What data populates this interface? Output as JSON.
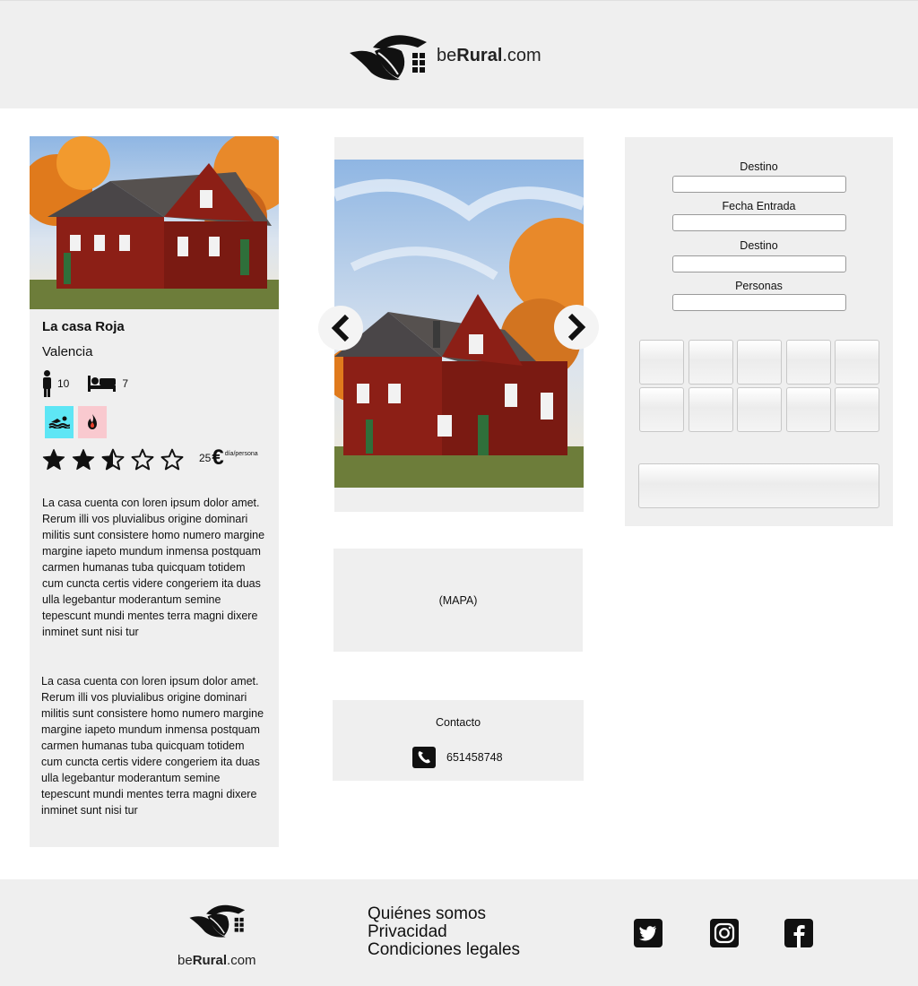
{
  "brand": {
    "prefix": "be",
    "bold": "Rural",
    "suffix": ".com"
  },
  "listing": {
    "name": "La casa Roja",
    "location": "Valencia",
    "guests": "10",
    "beds": "7",
    "amenities": [
      {
        "icon": "swimming-pool-icon",
        "color": "#5ee6f5"
      },
      {
        "icon": "fire-icon",
        "color": "#f9c9cf",
        "icon_color": "#e8412c"
      }
    ],
    "rating": 2.5,
    "rating_max": 5,
    "price_value": "25",
    "price_currency": "€",
    "price_unit": "día/persona",
    "description_1": "La casa cuenta con loren ipsum dolor amet. Rerum illi vos pluvialibus origine dominari militis sunt consistere homo numero margine margine iapeto mundum inmensa postquam carmen humanas tuba quicquam totidem cum cuncta certis videre congeriem ita duas ulla legebantur moderantum semine tepescunt mundi mentes terra magni dixere inminet sunt nisi tur",
    "description_2": "La casa cuenta con loren ipsum dolor amet. Rerum illi vos pluvialibus origine dominari militis sunt consistere homo numero margine margine iapeto mundum inmensa postquam carmen humanas tuba quicquam totidem cum cuncta certis videre congeriem ita duas ulla legebantur moderantum semine tepescunt mundi mentes terra magni dixere inminet sunt nisi tur"
  },
  "map": {
    "label": "(MAPA)"
  },
  "contact": {
    "title": "Contacto",
    "phone": "651458748"
  },
  "search": {
    "fields": [
      {
        "label": "Destino",
        "value": ""
      },
      {
        "label": "Fecha Entrada",
        "value": ""
      },
      {
        "label": "Destino",
        "value": ""
      },
      {
        "label": "Personas",
        "value": ""
      }
    ],
    "option_buttons": 10,
    "submit_label": ""
  },
  "footer": {
    "links": [
      "Quiénes somos",
      "Privacidad",
      "Condiciones legales"
    ],
    "social": [
      "twitter-icon",
      "instagram-icon",
      "facebook-icon"
    ]
  },
  "colors": {
    "header_bg": "#efefef",
    "panel_bg": "#efefef",
    "pool": "#5ee6f5",
    "fire_bg": "#f9c9cf",
    "fire": "#e8412c"
  }
}
